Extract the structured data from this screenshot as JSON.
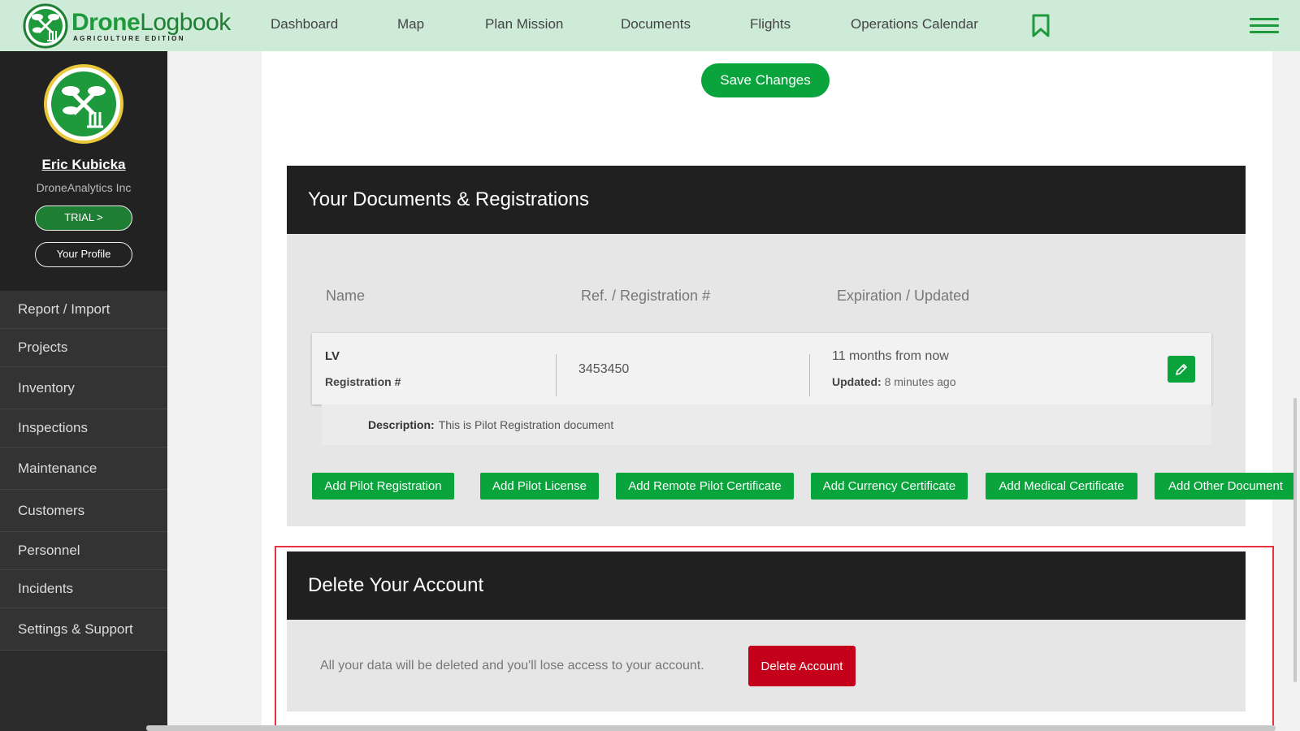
{
  "app": {
    "logo_word_bold": "Drone",
    "logo_word_regular": "Logbook",
    "logo_subtitle": "AGRICULTURE EDITION"
  },
  "nav": {
    "items": [
      "Dashboard",
      "Map",
      "Plan Mission",
      "Documents",
      "Flights",
      "Operations Calendar"
    ],
    "bookmark_icon": "bookmark-icon",
    "menu_icon": "hamburger-menu-icon"
  },
  "sidebar": {
    "user_name": "Eric Kubicka",
    "company": "DroneAnalytics Inc",
    "trial_label": "TRIAL >",
    "profile_label": "Your Profile",
    "menu": [
      "Report / Import",
      "Projects",
      "Inventory",
      "Inspections",
      "Maintenance",
      "Customers",
      "Personnel",
      "Incidents",
      "Settings & Support"
    ]
  },
  "main": {
    "save_label": "Save Changes",
    "documents": {
      "title": "Your Documents & Registrations",
      "headers": [
        "Name",
        "Ref. / Registration #",
        "Expiration / Updated"
      ],
      "row": {
        "name": "LV",
        "type": "Registration #",
        "ref": "3453450",
        "expiration": "11 months from now",
        "updated_label": "Updated:",
        "updated_value": "8 minutes ago",
        "description_label": "Description:",
        "description_value": "This is Pilot Registration document"
      },
      "add_buttons": [
        "Add Pilot Registration",
        "Add Pilot License",
        "Add Remote Pilot Certificate",
        "Add Currency Certificate",
        "Add Medical Certificate",
        "Add Other Document"
      ]
    },
    "delete_account": {
      "title": "Delete Your Account",
      "text": "All your data will be deleted and you'll lose access to your account.",
      "button_label": "Delete Account"
    }
  },
  "colors": {
    "brand_green": "#0aa43c",
    "nav_bg": "#cdebd6",
    "danger_red": "#c4001b",
    "highlight_red": "#e5333f"
  }
}
